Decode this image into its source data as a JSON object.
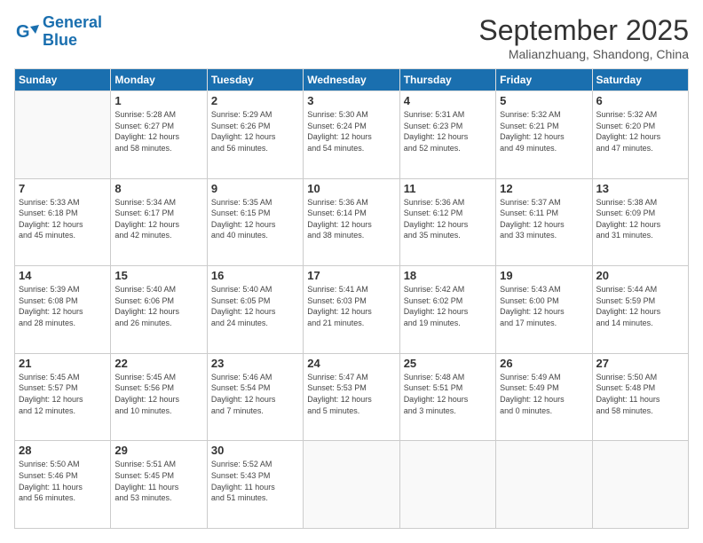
{
  "logo": {
    "line1": "General",
    "line2": "Blue"
  },
  "title": "September 2025",
  "subtitle": "Malianzhuang, Shandong, China",
  "weekdays": [
    "Sunday",
    "Monday",
    "Tuesday",
    "Wednesday",
    "Thursday",
    "Friday",
    "Saturday"
  ],
  "weeks": [
    [
      {
        "day": "",
        "info": ""
      },
      {
        "day": "1",
        "info": "Sunrise: 5:28 AM\nSunset: 6:27 PM\nDaylight: 12 hours\nand 58 minutes."
      },
      {
        "day": "2",
        "info": "Sunrise: 5:29 AM\nSunset: 6:26 PM\nDaylight: 12 hours\nand 56 minutes."
      },
      {
        "day": "3",
        "info": "Sunrise: 5:30 AM\nSunset: 6:24 PM\nDaylight: 12 hours\nand 54 minutes."
      },
      {
        "day": "4",
        "info": "Sunrise: 5:31 AM\nSunset: 6:23 PM\nDaylight: 12 hours\nand 52 minutes."
      },
      {
        "day": "5",
        "info": "Sunrise: 5:32 AM\nSunset: 6:21 PM\nDaylight: 12 hours\nand 49 minutes."
      },
      {
        "day": "6",
        "info": "Sunrise: 5:32 AM\nSunset: 6:20 PM\nDaylight: 12 hours\nand 47 minutes."
      }
    ],
    [
      {
        "day": "7",
        "info": "Sunrise: 5:33 AM\nSunset: 6:18 PM\nDaylight: 12 hours\nand 45 minutes."
      },
      {
        "day": "8",
        "info": "Sunrise: 5:34 AM\nSunset: 6:17 PM\nDaylight: 12 hours\nand 42 minutes."
      },
      {
        "day": "9",
        "info": "Sunrise: 5:35 AM\nSunset: 6:15 PM\nDaylight: 12 hours\nand 40 minutes."
      },
      {
        "day": "10",
        "info": "Sunrise: 5:36 AM\nSunset: 6:14 PM\nDaylight: 12 hours\nand 38 minutes."
      },
      {
        "day": "11",
        "info": "Sunrise: 5:36 AM\nSunset: 6:12 PM\nDaylight: 12 hours\nand 35 minutes."
      },
      {
        "day": "12",
        "info": "Sunrise: 5:37 AM\nSunset: 6:11 PM\nDaylight: 12 hours\nand 33 minutes."
      },
      {
        "day": "13",
        "info": "Sunrise: 5:38 AM\nSunset: 6:09 PM\nDaylight: 12 hours\nand 31 minutes."
      }
    ],
    [
      {
        "day": "14",
        "info": "Sunrise: 5:39 AM\nSunset: 6:08 PM\nDaylight: 12 hours\nand 28 minutes."
      },
      {
        "day": "15",
        "info": "Sunrise: 5:40 AM\nSunset: 6:06 PM\nDaylight: 12 hours\nand 26 minutes."
      },
      {
        "day": "16",
        "info": "Sunrise: 5:40 AM\nSunset: 6:05 PM\nDaylight: 12 hours\nand 24 minutes."
      },
      {
        "day": "17",
        "info": "Sunrise: 5:41 AM\nSunset: 6:03 PM\nDaylight: 12 hours\nand 21 minutes."
      },
      {
        "day": "18",
        "info": "Sunrise: 5:42 AM\nSunset: 6:02 PM\nDaylight: 12 hours\nand 19 minutes."
      },
      {
        "day": "19",
        "info": "Sunrise: 5:43 AM\nSunset: 6:00 PM\nDaylight: 12 hours\nand 17 minutes."
      },
      {
        "day": "20",
        "info": "Sunrise: 5:44 AM\nSunset: 5:59 PM\nDaylight: 12 hours\nand 14 minutes."
      }
    ],
    [
      {
        "day": "21",
        "info": "Sunrise: 5:45 AM\nSunset: 5:57 PM\nDaylight: 12 hours\nand 12 minutes."
      },
      {
        "day": "22",
        "info": "Sunrise: 5:45 AM\nSunset: 5:56 PM\nDaylight: 12 hours\nand 10 minutes."
      },
      {
        "day": "23",
        "info": "Sunrise: 5:46 AM\nSunset: 5:54 PM\nDaylight: 12 hours\nand 7 minutes."
      },
      {
        "day": "24",
        "info": "Sunrise: 5:47 AM\nSunset: 5:53 PM\nDaylight: 12 hours\nand 5 minutes."
      },
      {
        "day": "25",
        "info": "Sunrise: 5:48 AM\nSunset: 5:51 PM\nDaylight: 12 hours\nand 3 minutes."
      },
      {
        "day": "26",
        "info": "Sunrise: 5:49 AM\nSunset: 5:49 PM\nDaylight: 12 hours\nand 0 minutes."
      },
      {
        "day": "27",
        "info": "Sunrise: 5:50 AM\nSunset: 5:48 PM\nDaylight: 11 hours\nand 58 minutes."
      }
    ],
    [
      {
        "day": "28",
        "info": "Sunrise: 5:50 AM\nSunset: 5:46 PM\nDaylight: 11 hours\nand 56 minutes."
      },
      {
        "day": "29",
        "info": "Sunrise: 5:51 AM\nSunset: 5:45 PM\nDaylight: 11 hours\nand 53 minutes."
      },
      {
        "day": "30",
        "info": "Sunrise: 5:52 AM\nSunset: 5:43 PM\nDaylight: 11 hours\nand 51 minutes."
      },
      {
        "day": "",
        "info": ""
      },
      {
        "day": "",
        "info": ""
      },
      {
        "day": "",
        "info": ""
      },
      {
        "day": "",
        "info": ""
      }
    ]
  ]
}
